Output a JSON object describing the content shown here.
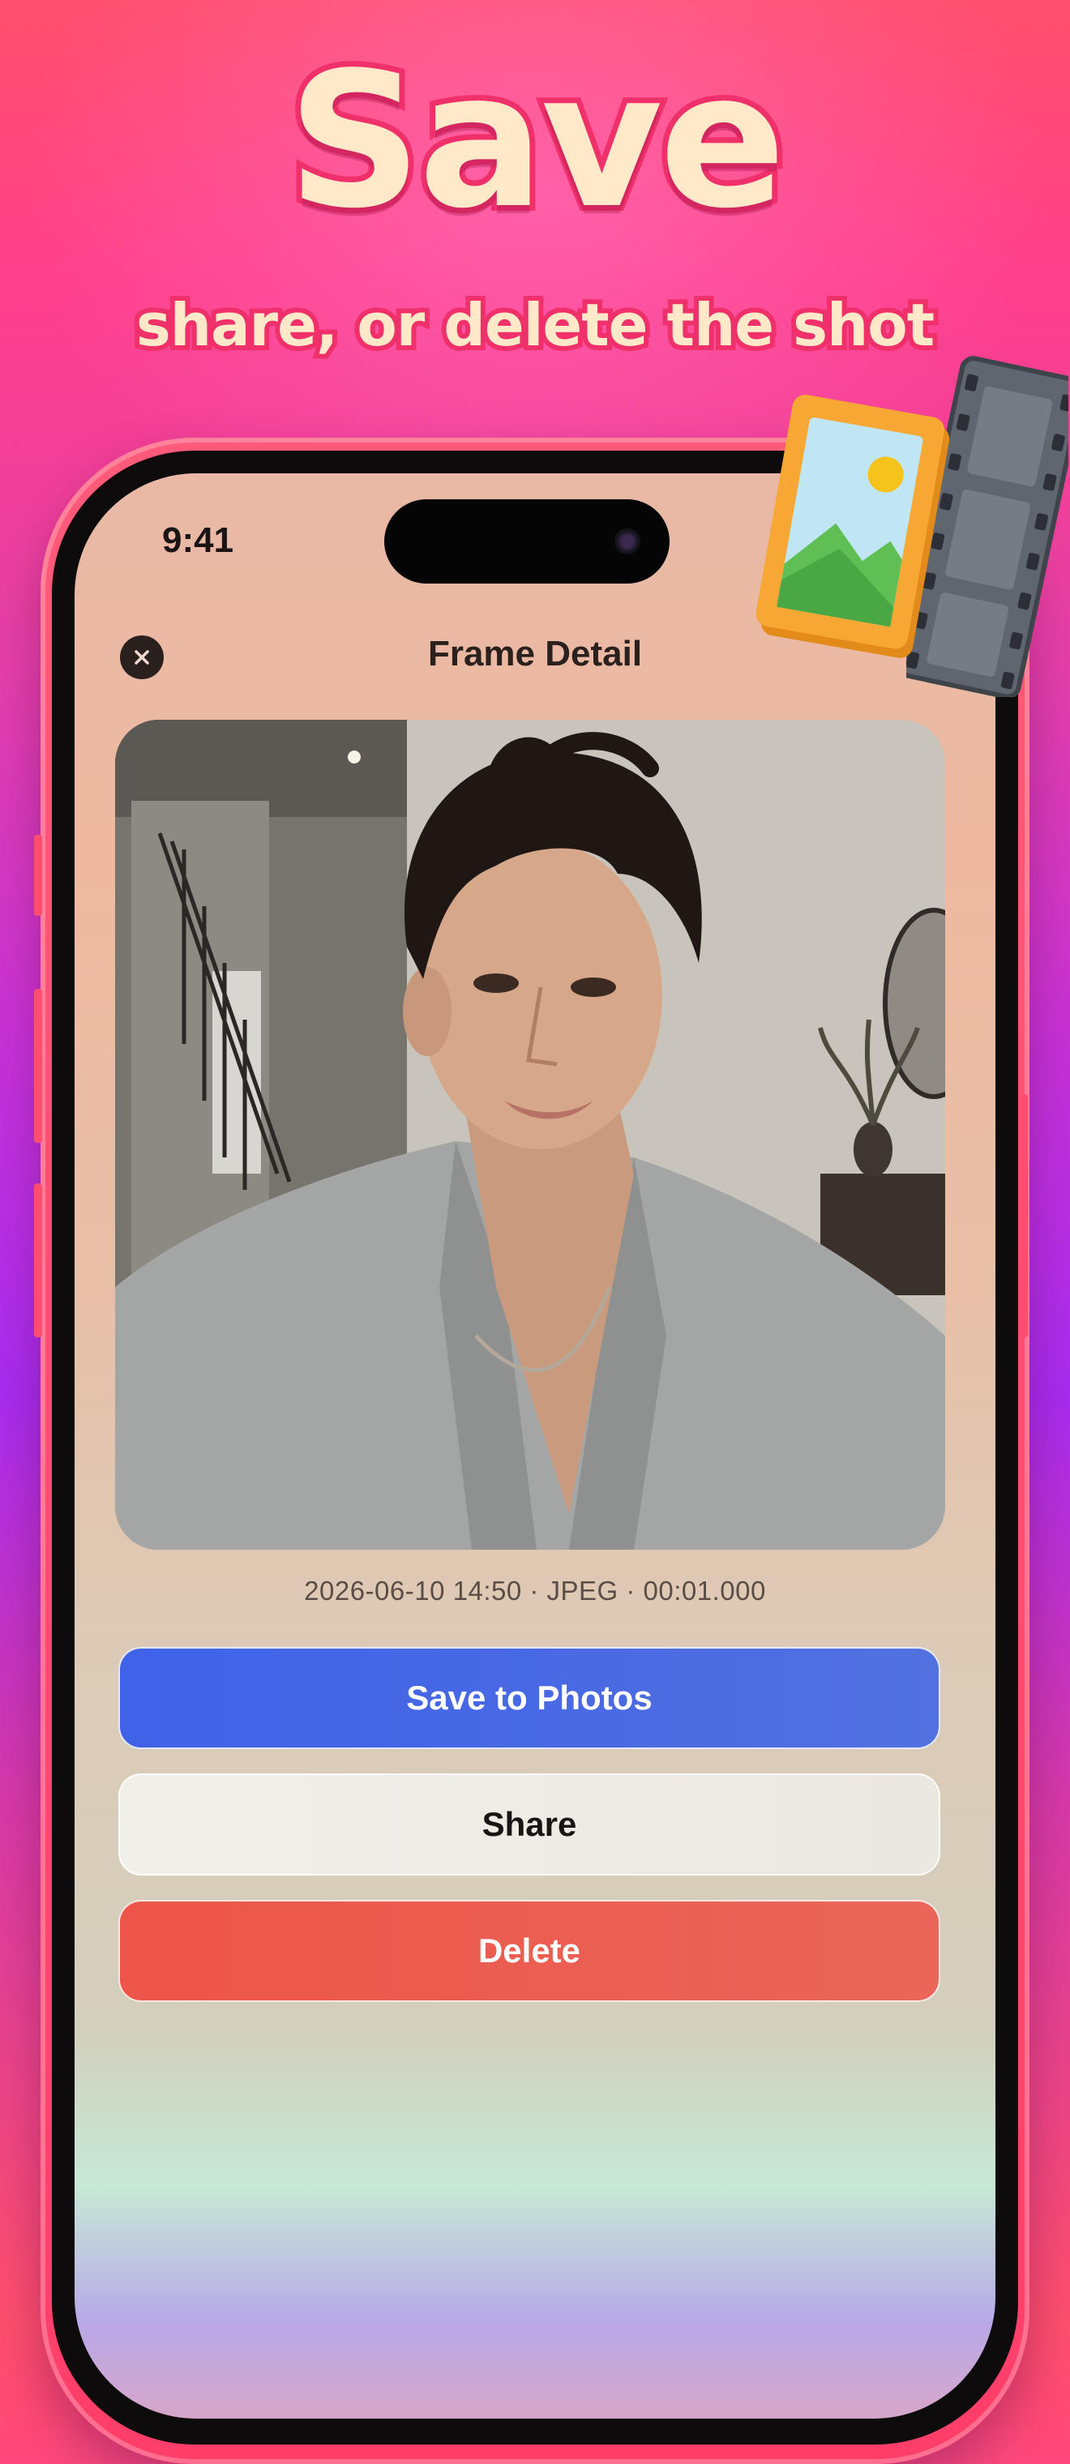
{
  "promo": {
    "headline": "Save",
    "subline": "share, or delete the shot"
  },
  "status_bar": {
    "time": "9:41"
  },
  "nav": {
    "title": "Frame Detail",
    "close_icon": "close-icon"
  },
  "photo": {
    "description_icon": "selfie-photo"
  },
  "meta": {
    "text": "2026-06-10 14:50 · JPEG · 00:01.000"
  },
  "actions": {
    "save_label": "Save to Photos",
    "share_label": "Share",
    "delete_label": "Delete"
  },
  "colors": {
    "save": "#4468e6",
    "share": "#eeece6",
    "delete": "#eb5d50",
    "phone_frame": "#ff4d6f"
  },
  "decorations": {
    "frame_icon": "picture-frame-icon",
    "film_icon": "film-strip-icon"
  }
}
